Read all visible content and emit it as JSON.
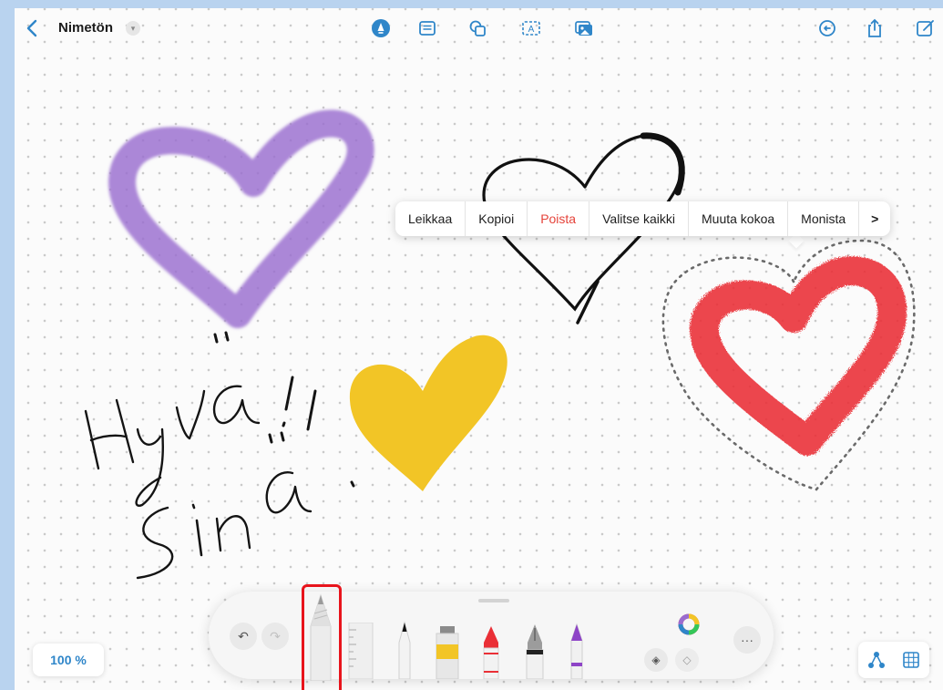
{
  "topbar": {
    "back_icon": "chevron-left-icon",
    "title": "Nimetön",
    "title_dropdown_icon": "chevron-down-icon",
    "center_tools": [
      "pen-tool-icon",
      "sticky-note-icon",
      "shapes-icon",
      "text-box-icon",
      "media-icon"
    ],
    "right_tools": [
      "history-icon",
      "share-icon",
      "new-board-icon"
    ]
  },
  "canvas": {
    "handwriting_line1": "Hyvä!",
    "handwriting_line2": "Sinä!",
    "drawings": [
      "purple-heart",
      "black-heart",
      "yellow-heart",
      "red-heart-selected"
    ]
  },
  "context_menu": {
    "items": [
      {
        "label": "Leikkaa",
        "danger": false
      },
      {
        "label": "Kopioi",
        "danger": false
      },
      {
        "label": "Poista",
        "danger": true
      },
      {
        "label": "Valitse kaikki",
        "danger": false
      },
      {
        "label": "Muuta kokoa",
        "danger": false
      },
      {
        "label": "Monista",
        "danger": false
      }
    ],
    "more_label": ">"
  },
  "palette": {
    "undo_icon": "undo-icon",
    "redo_icon": "redo-icon",
    "tools": [
      "pencil",
      "ruler",
      "fineliner",
      "paint-tube",
      "crayon",
      "fountain-pen",
      "marker"
    ],
    "selected_tool": "pencil",
    "color_picker_icon": "color-wheel-icon",
    "more_label": "···"
  },
  "zoom": {
    "label": "100 %"
  },
  "bottom_right": [
    "connector-icon",
    "grid-icon"
  ],
  "colors": {
    "accent": "#2f86c9",
    "danger": "#e5433a",
    "purple": "#9a6ccf",
    "yellow": "#f2c526",
    "red": "#ea2f36",
    "highlight": "#e8141c"
  }
}
